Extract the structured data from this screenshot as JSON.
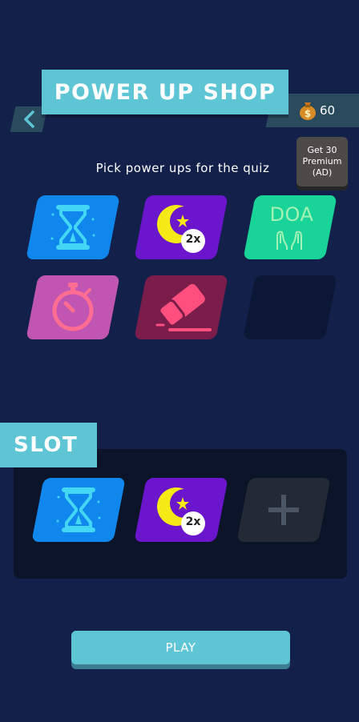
{
  "header": {
    "title": "POWER UP SHOP",
    "coins": "60",
    "premium_button": {
      "line1": "Get 30",
      "line2": "Premium",
      "line3": "(AD)"
    },
    "subtitle": "Pick power ups for the quiz"
  },
  "shop": {
    "items": [
      {
        "name": "hourglass",
        "icon": "hourglass-icon",
        "color": "#0f87ec"
      },
      {
        "name": "double-points",
        "icon": "crescent-moon-icon",
        "badge": "2x",
        "color": "#6b15cc"
      },
      {
        "name": "doa",
        "icon": "praying-hands-icon",
        "label": "DOA",
        "color": "#19d398"
      },
      {
        "name": "stopwatch",
        "icon": "stopwatch-icon",
        "color": "#c056b1"
      },
      {
        "name": "eraser",
        "icon": "eraser-icon",
        "color": "#7a1d4a"
      },
      {
        "name": "empty",
        "icon": "",
        "color": "#0c1735"
      }
    ]
  },
  "slot": {
    "title": "SLOT",
    "items": [
      {
        "name": "hourglass",
        "icon": "hourglass-icon"
      },
      {
        "name": "double-points",
        "icon": "crescent-moon-icon",
        "badge": "2x"
      },
      {
        "name": "add",
        "icon": "plus-icon"
      }
    ]
  },
  "play_label": "PLAY",
  "colors": {
    "background": "#13204a",
    "accent": "#5ec5d5",
    "panel": "#0b1428"
  }
}
